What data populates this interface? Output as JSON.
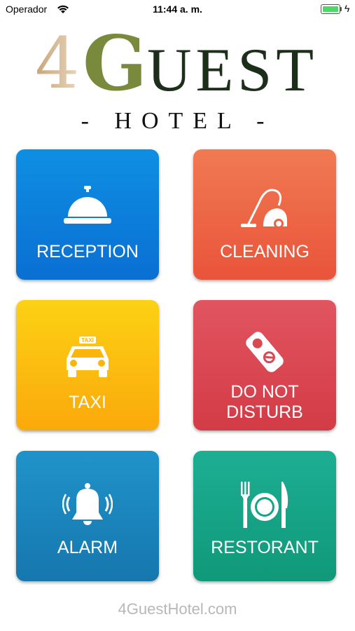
{
  "status_bar": {
    "carrier": "Operador",
    "time": "11:44 a. m.",
    "battery_icon": "battery-icon",
    "wifi_icon": "wifi-icon",
    "charging_icon": "bolt-icon",
    "bolt": "ϟ"
  },
  "logo": {
    "four": "4",
    "g": "G",
    "uest": "UEST",
    "subtitle": "- HOTEL -"
  },
  "tiles": [
    {
      "label": "RECEPTION",
      "icon": "service-bell-icon",
      "color": "#0a7fdc"
    },
    {
      "label": "CLEANING",
      "icon": "vacuum-cleaner-icon",
      "color": "#ec6344"
    },
    {
      "label": "TAXI",
      "icon": "taxi-icon",
      "color": "#fcbf10"
    },
    {
      "label_line1": "DO NOT",
      "label_line2": "DISTURB",
      "icon": "door-hanger-icon",
      "color": "#da4852"
    },
    {
      "label": "ALARM",
      "icon": "alarm-bell-icon",
      "color": "#1a85bc"
    },
    {
      "label": "RESTORANT",
      "icon": "plate-cutlery-icon",
      "color": "#16a486"
    }
  ],
  "footer": {
    "text": "4GuestHotel.com"
  }
}
